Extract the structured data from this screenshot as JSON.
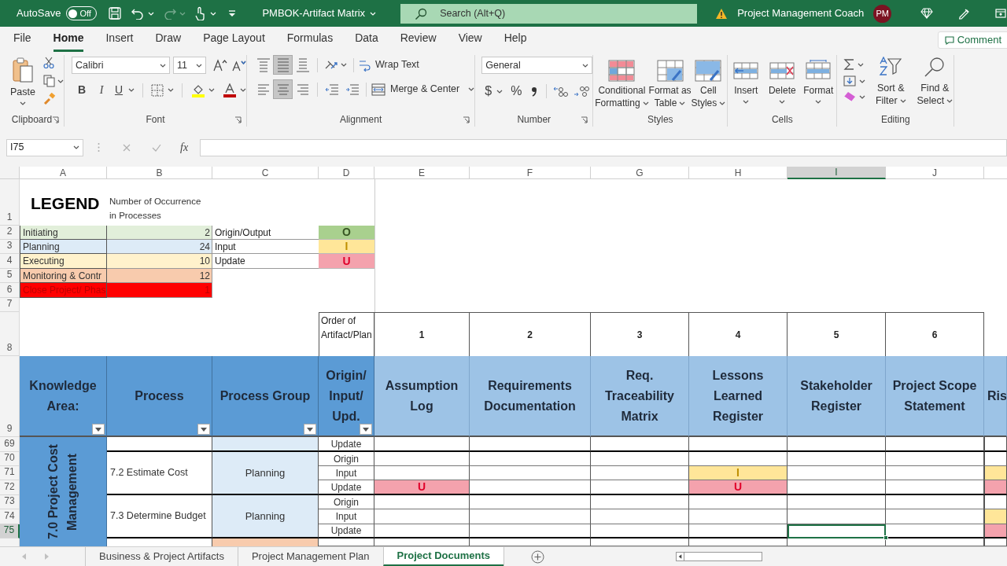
{
  "title_bar": {
    "autosave_label": "AutoSave",
    "autosave_state": "Off",
    "autosave_on": false,
    "redo_enabled": false,
    "document_title": "PMBOK-Artifact Matrix",
    "search_placeholder": "Search (Alt+Q)",
    "account_name": "Project Management Coach",
    "avatar_initials": "PM"
  },
  "ribbon_tabs": [
    {
      "label": "File",
      "selected": false
    },
    {
      "label": "Home",
      "selected": true
    },
    {
      "label": "Insert",
      "selected": false
    },
    {
      "label": "Draw",
      "selected": false
    },
    {
      "label": "Page Layout",
      "selected": false
    },
    {
      "label": "Formulas",
      "selected": false
    },
    {
      "label": "Data",
      "selected": false
    },
    {
      "label": "Review",
      "selected": false
    },
    {
      "label": "View",
      "selected": false
    },
    {
      "label": "Help",
      "selected": false
    }
  ],
  "comment_button": "Comment",
  "ribbon": {
    "paste_label": "Paste",
    "clipboard_group": "Clipboard",
    "font_name": "Calibri",
    "font_size": "11",
    "bold_label": "B",
    "italic_label": "I",
    "underline_label": "U",
    "font_group": "Font",
    "vertical_align": [
      {
        "kind": "top",
        "selected": false
      },
      {
        "kind": "middle",
        "selected": true
      },
      {
        "kind": "bottom",
        "selected": false
      }
    ],
    "horizontal_align": [
      {
        "kind": "left",
        "selected": false
      },
      {
        "kind": "center",
        "selected": true
      },
      {
        "kind": "right",
        "selected": false
      }
    ],
    "wrap_text": "Wrap Text",
    "merge_center": "Merge & Center",
    "alignment_group": "Alignment",
    "number_format": "General",
    "currency_label": "$",
    "percent_label": "%",
    "number_group": "Number",
    "styles_buttons": [
      {
        "kind": "conditional",
        "lines": [
          "Conditional",
          "Formatting"
        ]
      },
      {
        "kind": "table",
        "lines": [
          "Format as",
          "Table"
        ]
      },
      {
        "kind": "cellstyles",
        "lines": [
          "Cell",
          "Styles"
        ]
      }
    ],
    "styles_group": "Styles",
    "cells_buttons": [
      {
        "kind": "insert",
        "label": "Insert"
      },
      {
        "kind": "delete",
        "label": "Delete"
      },
      {
        "kind": "format",
        "label": "Format"
      }
    ],
    "cells_group": "Cells",
    "editing_buttons": [
      {
        "kind": "sort",
        "lines": [
          "Sort &",
          "Filter"
        ]
      },
      {
        "kind": "find",
        "lines": [
          "Find &",
          "Select"
        ]
      }
    ],
    "editing_group": "Editing"
  },
  "formula_bar": {
    "name_box": "I75",
    "function_label": "fx"
  },
  "columns": [
    {
      "letter": "A",
      "selected": false
    },
    {
      "letter": "B",
      "selected": false
    },
    {
      "letter": "C",
      "selected": false
    },
    {
      "letter": "D",
      "selected": false
    },
    {
      "letter": "E",
      "selected": false
    },
    {
      "letter": "F",
      "selected": false
    },
    {
      "letter": "G",
      "selected": false
    },
    {
      "letter": "H",
      "selected": false
    },
    {
      "letter": "I",
      "selected": true
    },
    {
      "letter": "J",
      "selected": false
    }
  ],
  "row_headers": [
    {
      "label": "1",
      "selected": false
    },
    {
      "label": "2",
      "selected": false
    },
    {
      "label": "3",
      "selected": false
    },
    {
      "label": "4",
      "selected": false
    },
    {
      "label": "5",
      "selected": false
    },
    {
      "label": "6",
      "selected": false
    },
    {
      "label": "7",
      "selected": false
    },
    {
      "label": "8",
      "selected": false
    },
    {
      "label": "9",
      "selected": false
    },
    {
      "label": "69",
      "selected": false
    },
    {
      "label": "70",
      "selected": false
    },
    {
      "label": "71",
      "selected": false
    },
    {
      "label": "72",
      "selected": false
    },
    {
      "label": "73",
      "selected": false
    },
    {
      "label": "74",
      "selected": false
    },
    {
      "label": "75",
      "selected": true
    }
  ],
  "sheet": {
    "legend_title": "LEGEND",
    "legend_subtitle": "Number of Occurrence in Processes",
    "process_groups": [
      {
        "name": "Initiating",
        "count": "2",
        "color": "#e2efda"
      },
      {
        "name": "Planning",
        "count": "24",
        "color": "#ddebf7"
      },
      {
        "name": "Executing",
        "count": "10",
        "color": "#fff2cc"
      },
      {
        "name": "Monitoring & Contr",
        "count": "12",
        "color": "#f8cbad"
      },
      {
        "name": "Close Project/ Phas",
        "count": "1",
        "color": "#ff0000"
      }
    ],
    "markers": [
      {
        "kind": "origin",
        "label": "Origin/Output",
        "color": "#a9d08e",
        "code": "O"
      },
      {
        "kind": "input",
        "label": "Input",
        "color": "#ffe699",
        "code": "I"
      },
      {
        "kind": "update",
        "label": "Update",
        "color": "#f4a2ad",
        "code": "U"
      }
    ],
    "order_label": "Order of Artifact/Plan",
    "headers": [
      "Knowledge Area:",
      "Process",
      "Process Group",
      "Origin/ Input/ Upd."
    ],
    "artifacts": [
      {
        "order": "1",
        "name": "Assumption Log"
      },
      {
        "order": "2",
        "name": "Requirements Documentation"
      },
      {
        "order": "3",
        "name": "Req. Traceability Matrix"
      },
      {
        "order": "4",
        "name": "Lessons Learned Register"
      },
      {
        "order": "5",
        "name": "Stakeholder Register"
      },
      {
        "order": "6",
        "name": "Project Scope Statement"
      },
      {
        "name": "Ris"
      }
    ],
    "knowledge_area": "7.0 Project Cost Management",
    "blocks": [
      {
        "color": "#ddebf7",
        "rows": [
          {
            "io": "Update",
            "cells": [
              {
                "kind": "blank"
              },
              {
                "kind": "blank"
              },
              {
                "kind": "blank"
              },
              {
                "kind": "blank"
              },
              {
                "kind": "blank"
              },
              {
                "kind": "blank"
              },
              {
                "kind": "blank"
              }
            ]
          }
        ]
      },
      {
        "process": "7.2 Estimate Cost",
        "group": "Planning",
        "color": "#ddebf7",
        "rows": [
          {
            "io": "Origin",
            "cells": [
              {
                "kind": "blank"
              },
              {
                "kind": "blank"
              },
              {
                "kind": "blank"
              },
              {
                "kind": "blank"
              },
              {
                "kind": "blank"
              },
              {
                "kind": "blank"
              },
              {
                "kind": "blank"
              }
            ]
          },
          {
            "io": "Input",
            "cells": [
              {
                "kind": "blank"
              },
              {
                "kind": "blank"
              },
              {
                "kind": "blank"
              },
              {
                "kind": "input",
                "text": "I"
              },
              {
                "kind": "blank"
              },
              {
                "kind": "blank"
              },
              {
                "kind": "input"
              }
            ]
          },
          {
            "io": "Update",
            "cells": [
              {
                "kind": "update",
                "text": "U"
              },
              {
                "kind": "blank"
              },
              {
                "kind": "blank"
              },
              {
                "kind": "update",
                "text": "U"
              },
              {
                "kind": "blank"
              },
              {
                "kind": "blank"
              },
              {
                "kind": "update"
              }
            ]
          }
        ]
      },
      {
        "process": "7.3 Determine Budget",
        "group": "Planning",
        "color": "#ddebf7",
        "rows": [
          {
            "io": "Origin",
            "cells": [
              {
                "kind": "blank"
              },
              {
                "kind": "blank"
              },
              {
                "kind": "blank"
              },
              {
                "kind": "blank"
              },
              {
                "kind": "blank"
              },
              {
                "kind": "blank"
              },
              {
                "kind": "blank"
              }
            ]
          },
          {
            "io": "Input",
            "cells": [
              {
                "kind": "blank"
              },
              {
                "kind": "blank"
              },
              {
                "kind": "blank"
              },
              {
                "kind": "blank"
              },
              {
                "kind": "blank"
              },
              {
                "kind": "blank"
              },
              {
                "kind": "input"
              }
            ]
          },
          {
            "io": "Update",
            "cells": [
              {
                "kind": "blank"
              },
              {
                "kind": "blank"
              },
              {
                "kind": "blank"
              },
              {
                "kind": "blank"
              },
              {
                "kind": "blank"
              },
              {
                "kind": "blank"
              },
              {
                "kind": "update"
              }
            ]
          }
        ]
      },
      {
        "color": "#f8cbad"
      }
    ]
  },
  "sheet_tabs": [
    {
      "label": "Business & Project Artifacts",
      "selected": false
    },
    {
      "label": "Project Management Plan",
      "selected": false
    },
    {
      "label": "Project Documents",
      "selected": true
    }
  ]
}
